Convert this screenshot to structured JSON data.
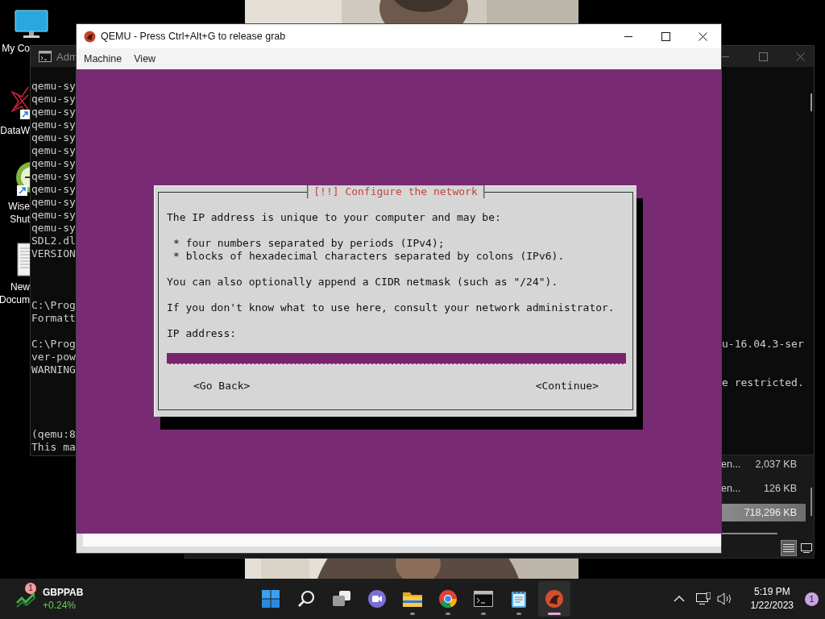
{
  "desktop_icons": [
    {
      "kind": "computer",
      "lines": [
        "My Co"
      ]
    },
    {
      "kind": "app",
      "lines": [
        "DataW"
      ]
    },
    {
      "kind": "clock",
      "lines": [
        "Wise",
        "Shut"
      ]
    },
    {
      "kind": "document",
      "lines": [
        "New",
        "Docum"
      ]
    }
  ],
  "console_window": {
    "title": "Adm",
    "blocks": [
      {
        "rows": [
          {
            "left": "qemu-sy"
          },
          {
            "left": "qemu-sy"
          },
          {
            "left": "qemu-sy"
          },
          {
            "left": "qemu-sy"
          },
          {
            "left": "qemu-sy"
          },
          {
            "left": "qemu-sy"
          },
          {
            "left": "qemu-sy"
          },
          {
            "left": "qemu-sy"
          },
          {
            "left": "qemu-sy"
          },
          {
            "left": "qemu-sy"
          },
          {
            "left": "qemu-sy"
          },
          {
            "left": "qemu-sy"
          },
          {
            "left": "SDL2.dl"
          },
          {
            "left": "VERSION"
          }
        ]
      },
      {
        "rows": [
          {
            "left": "C:\\Prog"
          },
          {
            "left": "Formatt"
          }
        ]
      },
      {
        "rows": [
          {
            "left": "C:\\Prog",
            "right": "u-16.04.3-ser"
          },
          {
            "left": "ver-pow"
          },
          {
            "left": "WARNING"
          },
          {
            "right": "e restricted."
          }
        ]
      },
      {
        "rows": [
          {
            "left": "(qemu:8"
          },
          {
            "left": "This ma"
          }
        ]
      }
    ]
  },
  "explorer_window": {
    "rows": [
      {
        "name": "en...",
        "size": "2,037 KB",
        "selected": false
      },
      {
        "name": "en...",
        "size": "126 KB",
        "selected": false
      },
      {
        "size": "718,296 KB",
        "selected": true
      }
    ],
    "view_buttons": [
      {
        "kind": "details",
        "selected": true
      },
      {
        "kind": "tiles",
        "selected": false
      }
    ]
  },
  "qemu_window": {
    "title": "QEMU - Press Ctrl+Alt+G to release grab",
    "menu": [
      "Machine",
      "View"
    ],
    "dialog": {
      "title": "[!!] Configure the network",
      "intro": "The IP address is unique to your computer and may be:",
      "bullets": [
        "* four numbers separated by periods (IPv4);",
        "* blocks of hexadecimal characters separated by colons (IPv6)."
      ],
      "notes": [
        "You can also optionally append a CIDR netmask (such as \"/24\").",
        "If you don't know what to use here, consult your network administrator."
      ],
      "field_label": "IP address:",
      "buttons": [
        "<Go Back>",
        "<Continue>"
      ]
    }
  },
  "taskbar": {
    "widget": {
      "badge": "1",
      "symbol": "GBPPAB",
      "change": "+0.24%"
    },
    "apps": [
      {
        "kind": "start",
        "running": false,
        "active": false
      },
      {
        "kind": "search",
        "running": false,
        "active": false
      },
      {
        "kind": "taskview",
        "running": false,
        "active": false
      },
      {
        "kind": "chat",
        "running": false,
        "active": false
      },
      {
        "kind": "files",
        "running": true,
        "active": false
      },
      {
        "kind": "browser",
        "running": true,
        "active": false
      },
      {
        "kind": "terminal",
        "running": true,
        "active": false
      },
      {
        "kind": "notepad",
        "running": true,
        "active": false
      },
      {
        "kind": "qemu",
        "running": true,
        "active": true
      }
    ],
    "clock": {
      "time": "5:19 PM",
      "date": "1/22/2023"
    },
    "notification_count": "1"
  }
}
